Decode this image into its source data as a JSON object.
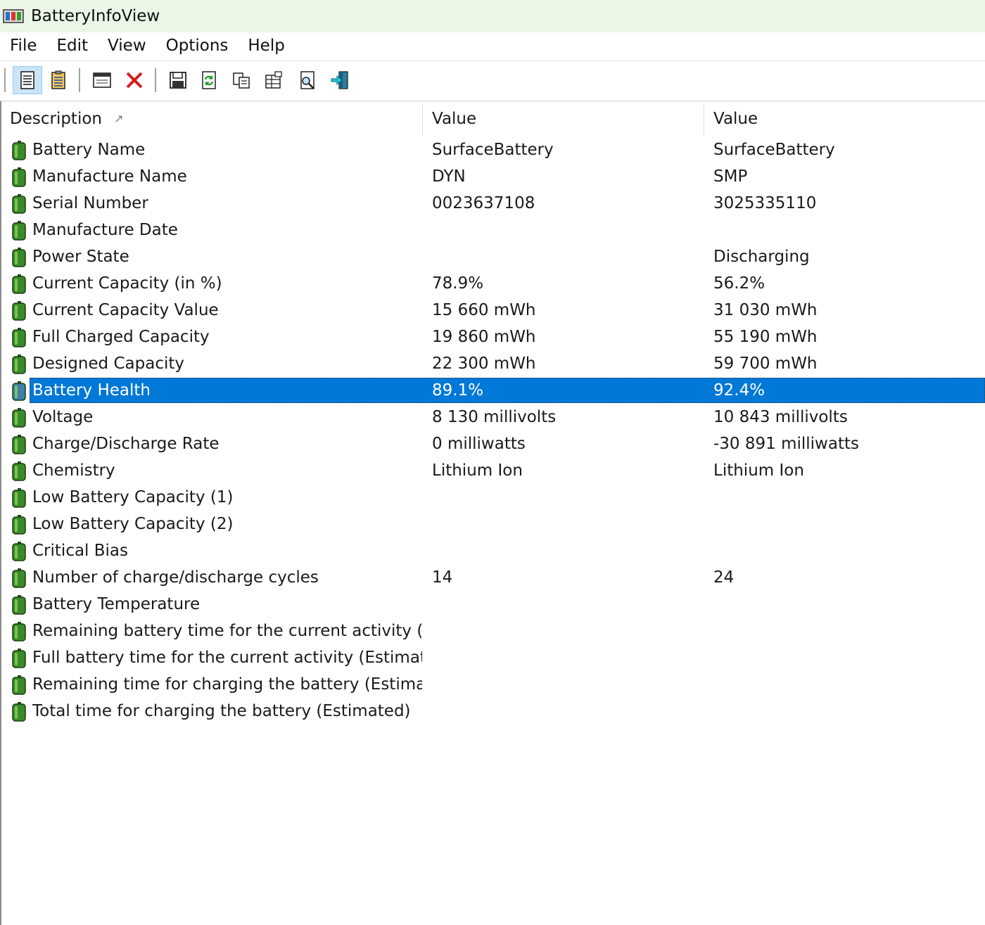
{
  "window": {
    "title": "BatteryInfoView"
  },
  "menu": [
    "File",
    "Edit",
    "View",
    "Options",
    "Help"
  ],
  "toolbar": {
    "buttons": [
      {
        "name": "properties-button",
        "icon": "properties-icon"
      },
      {
        "name": "html-report-button",
        "icon": "clipboard-icon"
      },
      {
        "name": "window-button",
        "icon": "window-icon"
      },
      {
        "name": "delete-button",
        "icon": "red-x-icon"
      },
      {
        "name": "save-button",
        "icon": "floppy-disk-icon"
      },
      {
        "name": "refresh-button",
        "icon": "refresh-icon"
      },
      {
        "name": "copy-button",
        "icon": "copy-icon"
      },
      {
        "name": "options-button",
        "icon": "properties-grid-icon"
      },
      {
        "name": "find-button",
        "icon": "find-icon"
      },
      {
        "name": "exit-button",
        "icon": "exit-icon"
      }
    ]
  },
  "columns": [
    "Description",
    "Value",
    "Value"
  ],
  "sort_indicator": "ascending",
  "colors": {
    "selection": "#0078d7",
    "battery": "#3a8a2a",
    "titlebar": "#eaf6e6"
  },
  "rows": [
    {
      "d": "Battery Name",
      "v1": "SurfaceBattery",
      "v2": "SurfaceBattery"
    },
    {
      "d": "Manufacture Name",
      "v1": "DYN",
      "v2": "SMP"
    },
    {
      "d": "Serial Number",
      "v1": "0023637108",
      "v2": "3025335110"
    },
    {
      "d": "Manufacture Date",
      "v1": "",
      "v2": ""
    },
    {
      "d": "Power State",
      "v1": "",
      "v2": "Discharging"
    },
    {
      "d": "Current Capacity (in %)",
      "v1": "78.9%",
      "v2": "56.2%"
    },
    {
      "d": "Current Capacity Value",
      "v1": "15 660 mWh",
      "v2": "31 030 mWh"
    },
    {
      "d": "Full Charged Capacity",
      "v1": "19 860 mWh",
      "v2": "55 190 mWh"
    },
    {
      "d": "Designed Capacity",
      "v1": "22 300 mWh",
      "v2": "59 700 mWh"
    },
    {
      "d": "Battery Health",
      "v1": "89.1%",
      "v2": "92.4%",
      "selected": true
    },
    {
      "d": "Voltage",
      "v1": "8 130 millivolts",
      "v2": "10 843 millivolts"
    },
    {
      "d": "Charge/Discharge Rate",
      "v1": "0 milliwatts",
      "v2": "-30 891 milliwatts"
    },
    {
      "d": "Chemistry",
      "v1": "Lithium Ion",
      "v2": "Lithium Ion"
    },
    {
      "d": "Low Battery Capacity (1)",
      "v1": "",
      "v2": ""
    },
    {
      "d": "Low Battery Capacity (2)",
      "v1": "",
      "v2": ""
    },
    {
      "d": "Critical Bias",
      "v1": "",
      "v2": ""
    },
    {
      "d": "Number of charge/discharge cycles",
      "v1": "14",
      "v2": "24"
    },
    {
      "d": "Battery Temperature",
      "v1": "",
      "v2": ""
    },
    {
      "d": "Remaining battery time for the current activity (Est...",
      "v1": "",
      "v2": ""
    },
    {
      "d": "Full battery time for the current activity (Estimated)",
      "v1": "",
      "v2": ""
    },
    {
      "d": "Remaining time for charging the battery (Estimated)",
      "v1": "",
      "v2": ""
    },
    {
      "d": "Total  time for charging the battery (Estimated)",
      "v1": "",
      "v2": ""
    }
  ]
}
